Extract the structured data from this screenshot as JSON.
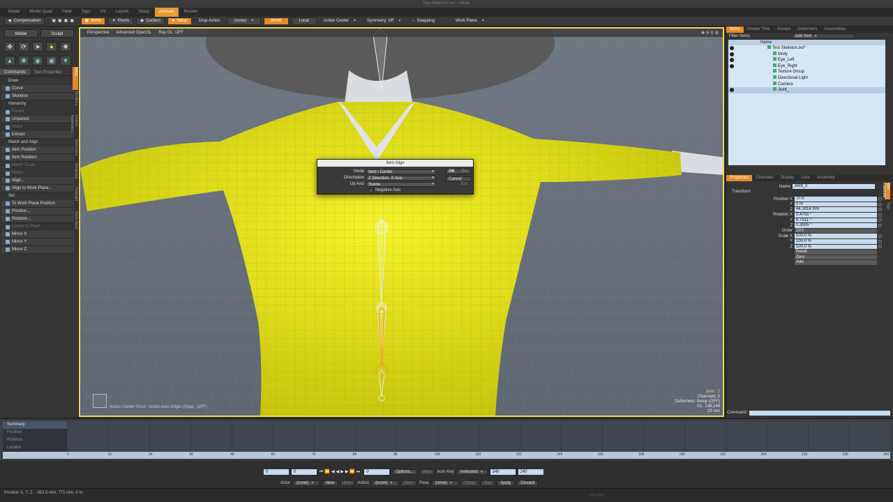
{
  "window": {
    "title": "Test Skeleton.lxo* - Modo"
  },
  "layout_tabs": {
    "items": [
      "Model",
      "Model Quad",
      "Paint",
      "Topo",
      "UV",
      "Layout",
      "Setup",
      "Animate",
      "Render"
    ],
    "active": "Animate"
  },
  "toolbar": {
    "compensation": "Compensation",
    "items": "Items",
    "pivots": "Pivots",
    "centers": "Centers",
    "setup": "Setup",
    "drop_action": "Drop Action",
    "drop_action_value": "(none)",
    "world": "World",
    "local": "Local",
    "action_center": "Action Center",
    "symmetry": "Symmetry: Off",
    "snapping": "Snapping",
    "work_plane": "Work Plane"
  },
  "left": {
    "mode_model": "Model",
    "mode_sculpt": "Sculpt",
    "tabs": [
      "Commands",
      "Tool Properties"
    ],
    "commands": [
      {
        "label": "Draw",
        "kind": "hdr"
      },
      {
        "label": "Curve",
        "kind": "btn"
      },
      {
        "label": "Skeleton",
        "kind": "btn"
      },
      {
        "label": "Hierarchy",
        "kind": "hdr"
      },
      {
        "label": "Parent",
        "kind": "dim"
      },
      {
        "label": "Unparent",
        "kind": "btn"
      },
      {
        "label": "Insert",
        "kind": "dim"
      },
      {
        "label": "Extract",
        "kind": "btn"
      },
      {
        "label": "Match and Align",
        "kind": "hdr"
      },
      {
        "label": "Item Position",
        "kind": "btn"
      },
      {
        "label": "Item Rotation",
        "kind": "btn"
      },
      {
        "label": "Match Scale",
        "kind": "dim"
      },
      {
        "label": "Match...",
        "kind": "dim"
      },
      {
        "label": "Align...",
        "kind": "btn"
      },
      {
        "label": "Align to Work Plane...",
        "kind": "btn"
      },
      {
        "label": "Set",
        "kind": "hdr"
      },
      {
        "label": "To Work Plane Position",
        "kind": "btn"
      },
      {
        "label": "Position...",
        "kind": "btn"
      },
      {
        "label": "Rotation...",
        "kind": "btn"
      },
      {
        "label": "Center to Pivot",
        "kind": "dim"
      },
      {
        "label": "Mirror X",
        "kind": "btn"
      },
      {
        "label": "Mirror Y",
        "kind": "btn"
      },
      {
        "label": "Mirror Z",
        "kind": "btn"
      }
    ],
    "vertical_tabs": [
      "Setup",
      "Modifiers",
      "Inverse Kinematics",
      "Deformers",
      "Weighting",
      "Retarget",
      "Audio Apply"
    ]
  },
  "viewport": {
    "view": "Perspective",
    "shading": "Advanced OpenGL",
    "raygl": "Ray GL: OFF",
    "status": "Action Center Pivot : Action Axis Origin  (Snap : OFF)",
    "info": [
      "Joint : 2",
      "Channels: 0",
      "Deformers: Setup (OFF)",
      "GL: 136,248",
      "10 mm"
    ]
  },
  "dialog": {
    "title": "Item Align",
    "mode_label": "Mode",
    "mode_value": "Item \\ Center",
    "orientation_label": "Orientation",
    "orientation_value": "Z Direction, X Axis",
    "up_axis_label": "Up Axis",
    "up_axis_value": "Scene",
    "negative_axis": "Negative Axis",
    "ok": "OK",
    "ok_key": "Ret",
    "cancel": "Cancel",
    "cancel_key": "Esc"
  },
  "right": {
    "tabs": [
      "Items",
      "Shader Tree",
      "Groups",
      "Deformers",
      "Assemblies"
    ],
    "filter_items": "Filter Items",
    "add_item": "Add Item",
    "name_col": "Name",
    "tree": [
      {
        "label": "Test Skeleton.lxo*",
        "indent": 0
      },
      {
        "label": "Molly",
        "indent": 1
      },
      {
        "label": "Eye_Left",
        "indent": 1
      },
      {
        "label": "Eye_Right",
        "indent": 1
      },
      {
        "label": "Texture Group",
        "indent": 1
      },
      {
        "label": "Directional Light",
        "indent": 1
      },
      {
        "label": "Camera",
        "indent": 1
      },
      {
        "label": "Joint_",
        "indent": 1
      }
    ],
    "prop_tabs": [
      "Properties",
      "Channels",
      "Display",
      "Lists",
      "Assembly"
    ],
    "transform": "Transform",
    "name_label": "Name",
    "name_value": "Joint_2",
    "props": [
      {
        "label": "Position X",
        "value": "-0 m"
      },
      {
        "label": "Y",
        "value": "0 m"
      },
      {
        "label": "Z",
        "value": "44.1814 mm"
      },
      {
        "label": "Rotation X",
        "value": "0.4755 °"
      },
      {
        "label": "Y",
        "value": "8.7511 °"
      },
      {
        "label": "Z",
        "value": "0.3905 °"
      },
      {
        "label": "Order",
        "value": "ZXY"
      },
      {
        "label": "Scale X",
        "value": "100.0 %"
      },
      {
        "label": "Y",
        "value": "100.0 %"
      },
      {
        "label": "Z",
        "value": "100.0 %"
      },
      {
        "label": "",
        "value": "Reset"
      },
      {
        "label": "",
        "value": "Zero"
      },
      {
        "label": "",
        "value": "Add"
      }
    ],
    "side_tabs": [
      "User Channels",
      "Tags"
    ],
    "command": "Command"
  },
  "timeline": {
    "rows": [
      "Summary",
      "Position",
      "Rotation",
      "Locator"
    ],
    "ticks": [
      "0",
      "12",
      "24",
      "36",
      "48",
      "60",
      "72",
      "84",
      "96",
      "108",
      "120",
      "132",
      "144",
      "156",
      "168",
      "180",
      "192",
      "204",
      "216",
      "228",
      "240"
    ]
  },
  "transport": {
    "start": "0",
    "current": "0",
    "frame": "0",
    "options": "Options...",
    "key": "Key",
    "auto_key": "Auto Key",
    "animated": "Animated",
    "end1": "240",
    "end2": "240",
    "actor_label": "Actor",
    "actor_value": "(none)",
    "new": "New",
    "key2": "Key",
    "action_label": "Action",
    "action_value": "(none)",
    "new2": "New",
    "pose_label": "Pose",
    "pose_value": "(none)",
    "store": "Store",
    "set": "Set",
    "apply": "Apply",
    "discard": "Discard"
  },
  "status": {
    "position": "Position X, Y, Z  :  -353.5 mm, 771 mm, 0 m",
    "center": "(no info)"
  },
  "colors": {
    "accent": "#e58b2a",
    "viewport_border": "#e8d75a",
    "shirt": "#e8e619"
  }
}
